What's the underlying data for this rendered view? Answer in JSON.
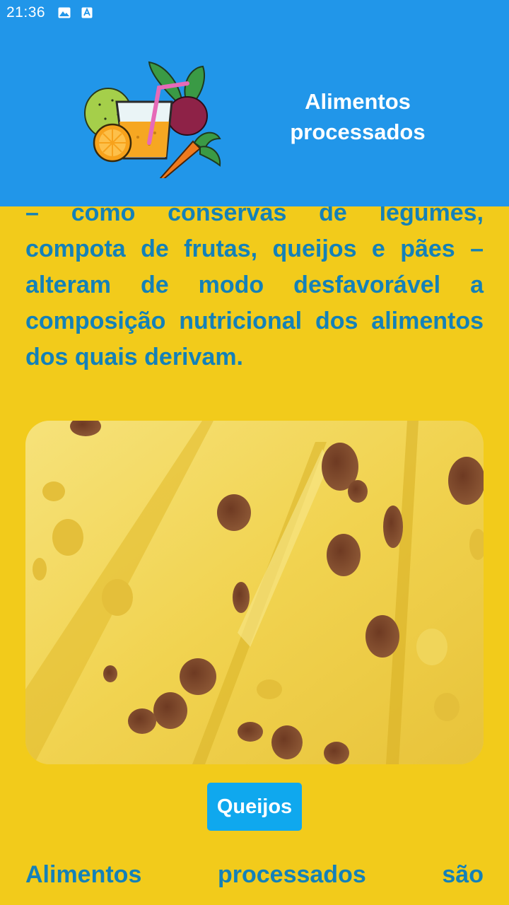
{
  "status_bar": {
    "time": "21:36",
    "icons": [
      "image-notification-icon",
      "keyboard-notification-icon"
    ]
  },
  "header": {
    "title": "Alimentos processados",
    "logo_icon": "fruit-juice-vegetables-logo",
    "background_color": "#2196E9"
  },
  "content": {
    "paragraph_top": "– como conservas de legumes, compota de frutas, queijos e pães – alteram de modo desfavorável a composição nutricional dos alimentos dos quais derivam.",
    "image_icon": "swiss-cheese-slices-photo",
    "caption_button_label": "Queijos",
    "paragraph_bottom": "Alimentos processados são",
    "text_color": "#1481B8",
    "background_color": "#F2CB1B",
    "button_color": "#0FA8EE"
  }
}
